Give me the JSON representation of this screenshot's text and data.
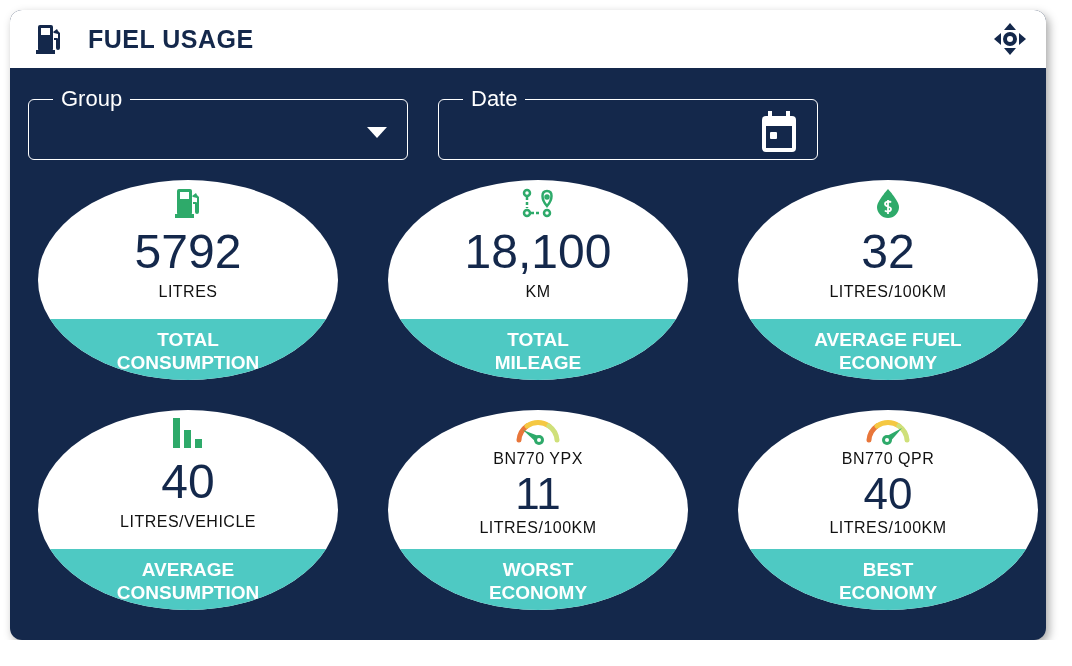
{
  "header": {
    "title": "FUEL USAGE"
  },
  "filters": [
    {
      "kind": "dropdown",
      "label": "Group"
    },
    {
      "kind": "date",
      "label": "Date"
    }
  ],
  "tiles": [
    {
      "kind": "consumption",
      "value": "5792",
      "unit": "LITRES",
      "caption": [
        "TOTAL",
        "CONSUMPTION"
      ]
    },
    {
      "kind": "mileage",
      "value": "18,100",
      "unit": "KM",
      "caption": [
        "TOTAL",
        "MILEAGE"
      ]
    },
    {
      "kind": "economy",
      "value": "32",
      "unit": "LITRES/100KM",
      "caption": [
        "AVERAGE FUEL",
        "ECONOMY"
      ]
    },
    {
      "kind": "per-vehicle",
      "value": "40",
      "unit": "LITRES/VEHICLE",
      "caption": [
        "AVERAGE",
        "CONSUMPTION"
      ]
    },
    {
      "kind": "worst",
      "vehicle": "BN770 YPX",
      "value": "11",
      "unit": "LITRES/100KM",
      "caption": [
        "WORST",
        "ECONOMY"
      ]
    },
    {
      "kind": "best",
      "vehicle": "BN770 QPR",
      "value": "40",
      "unit": "LITRES/100KM",
      "caption": [
        "BEST",
        "ECONOMY"
      ]
    }
  ]
}
